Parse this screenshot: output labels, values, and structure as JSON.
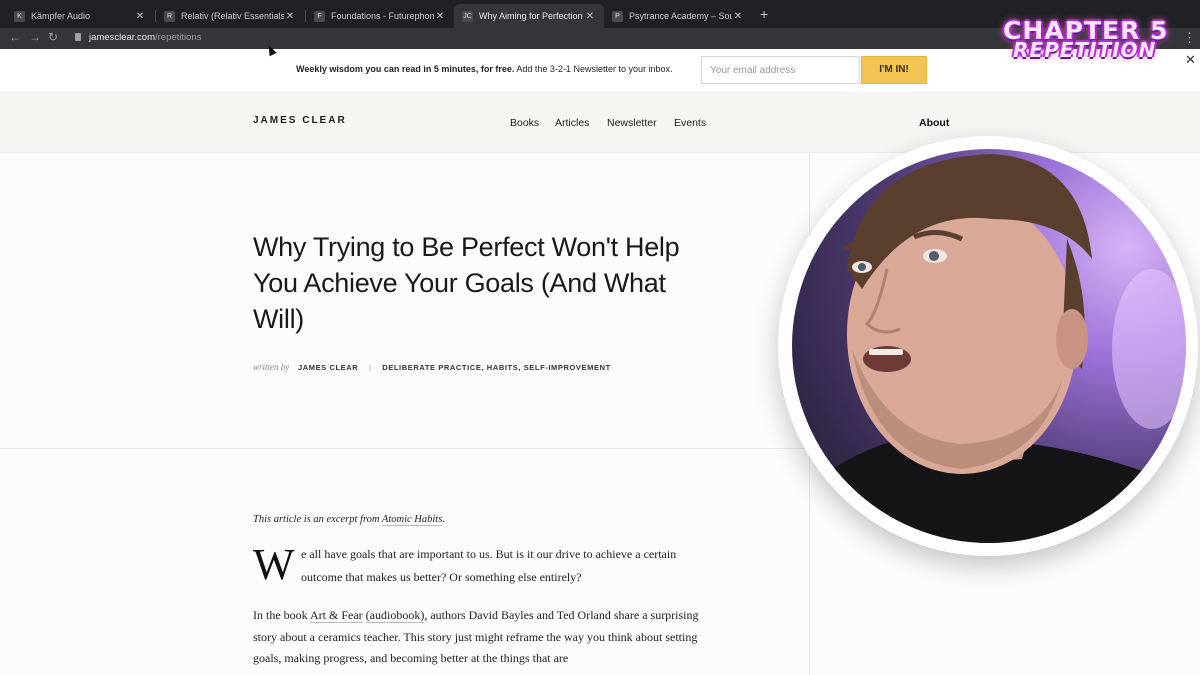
{
  "browser": {
    "tabs": [
      {
        "title": "Kämpfer Audio",
        "favicon": "K"
      },
      {
        "title": "Relativ (Relativ Essentials)",
        "favicon": "R"
      },
      {
        "title": "Foundations - Futurephonic",
        "favicon": "F"
      },
      {
        "title": "Why Aiming for Perfection Won",
        "favicon": "JC"
      },
      {
        "title": "Psytrance Academy – Sound P",
        "favicon": "P"
      }
    ],
    "url_domain": "jamesclear.com",
    "url_path": "/repetitions"
  },
  "overlay": {
    "chapter_line1": "CHAPTER 5",
    "chapter_line2": "REPETITION"
  },
  "banner": {
    "bold_text": "Weekly wisdom you can read in 5 minutes, for free.",
    "text": " Add the 3-2-1 Newsletter to your inbox.",
    "email_placeholder": "Your email address",
    "submit_label": "I'M IN!",
    "accent_color": "#f2c452"
  },
  "header": {
    "logo": "JAMES CLEAR",
    "nav": [
      "Books",
      "Articles",
      "Newsletter",
      "Events"
    ],
    "about": "About"
  },
  "article": {
    "title": "Why Trying to Be Perfect Won't Help You Achieve Your Goals (And What Will)",
    "written_by": "written by",
    "author": "JAMES CLEAR",
    "categories": [
      "DELIBERATE PRACTICE,",
      "HABITS,",
      "SELF-IMPROVEMENT"
    ],
    "excerpt_prefix": "This article is an excerpt from ",
    "excerpt_link": "Atomic Habits",
    "excerpt_suffix": ".",
    "dropcap": "W",
    "p1_line1": "e all have goals that are important to us. But is it our drive to achieve a certain",
    "p1_line2": "outcome that makes us better? Or something else entirely?",
    "p2_prefix": "In the book ",
    "p2_link1": "Art & Fear",
    "p2_mid": " ",
    "p2_link2": "(audiobook)",
    "p2_rest": ", authors David Bayles and Ted Orland share a surprising story about a ceramics teacher. This story just might reframe the way you think about setting goals, making progress, and becoming better at the things that are"
  }
}
